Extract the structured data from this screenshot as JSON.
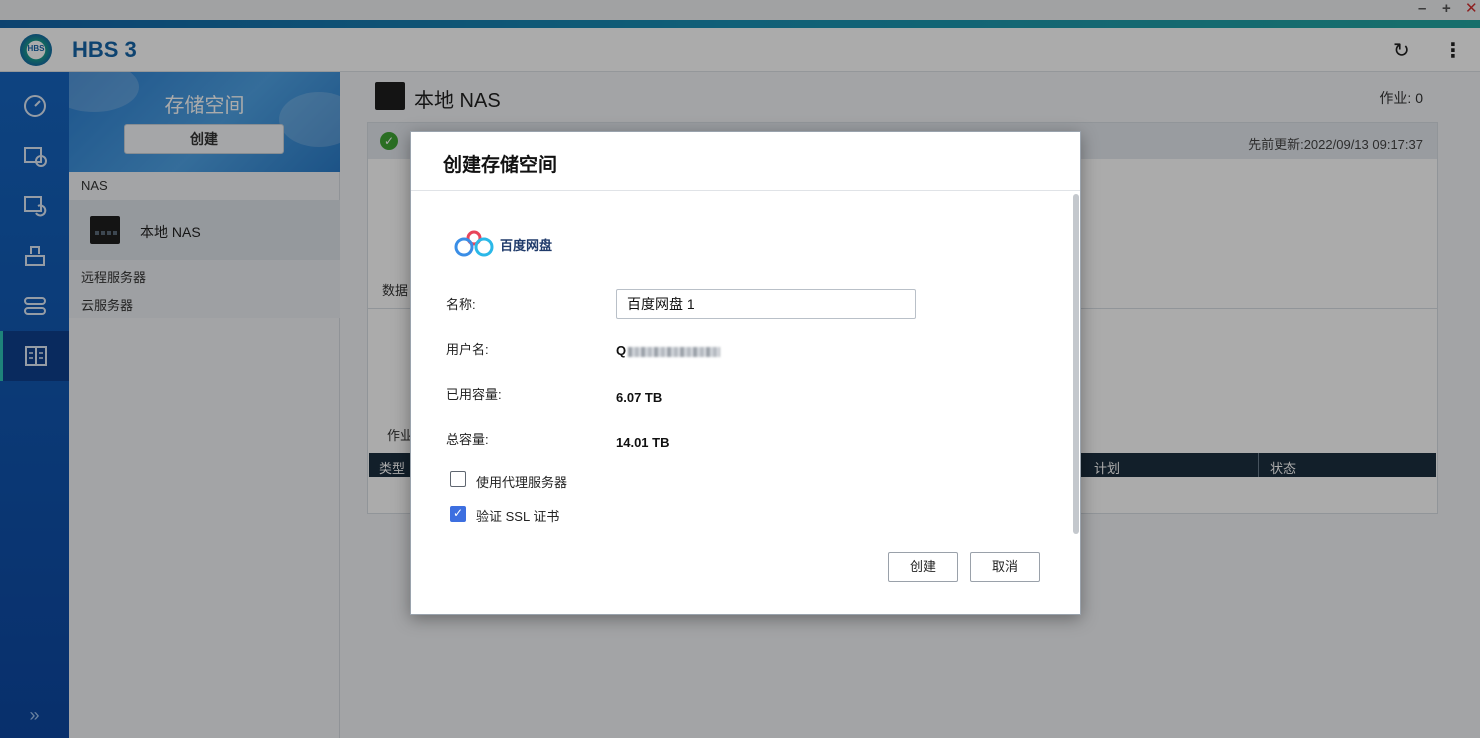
{
  "window": {
    "minimize": "–",
    "maximize": "+",
    "close": "✕"
  },
  "header": {
    "logo_text": "HBS",
    "app_title": "HBS 3",
    "refresh_icon": "↻",
    "more_icon": "⋮"
  },
  "rail": {
    "items": [
      "dashboard-icon",
      "backup-icon",
      "restore-icon",
      "sync-icon",
      "services-icon",
      "storage-spaces-icon"
    ],
    "expand": "»"
  },
  "panel": {
    "title": "存储空间",
    "create_label": "创建",
    "nas_group": "NAS",
    "nas_item": "本地 NAS",
    "remote_servers": "远程服务器",
    "cloud_servers": "云服务器"
  },
  "main": {
    "title": "本地 NAS",
    "jobs": "作业: 0",
    "updated": "先前更新:2022/09/13 09:17:37",
    "data_label": "数据",
    "jobs_label": "作业",
    "table_headers": {
      "type": "类型",
      "schedule": "计划",
      "status": "状态"
    }
  },
  "dialog": {
    "title": "创建存储空间",
    "service_name": "百度网盘",
    "name_label": "名称:",
    "name_value": "百度网盘 1",
    "username_label": "用户名:",
    "username_visible": "Q",
    "used_label": "已用容量:",
    "used_value": "6.07  TB",
    "total_label": "总容量:",
    "total_value": "14.01  TB",
    "proxy_label": "使用代理服务器",
    "proxy_checked": false,
    "ssl_label": "验证 SSL 证书",
    "ssl_checked": true,
    "create_button": "创建",
    "cancel_button": "取消"
  },
  "colors": {
    "brand": "#1565a8",
    "rail": "#1565c0",
    "checkbox_on": "#3d6fe0",
    "ok": "#3fa535",
    "table_header": "#1c2f3f"
  }
}
